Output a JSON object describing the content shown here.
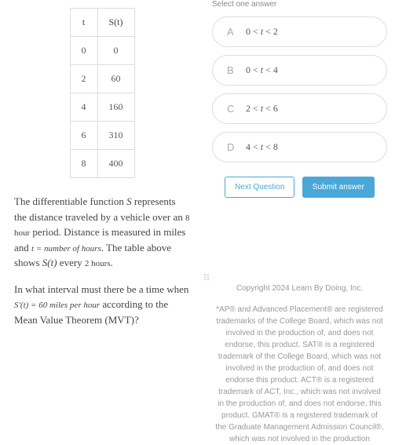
{
  "table": {
    "headers": [
      "t",
      "S(t)"
    ],
    "rows": [
      [
        "0",
        "0"
      ],
      [
        "2",
        "60"
      ],
      [
        "4",
        "160"
      ],
      [
        "6",
        "310"
      ],
      [
        "8",
        "400"
      ]
    ]
  },
  "question": {
    "p1_a": "The differentiable function ",
    "p1_S": "S",
    "p1_b": " represents the distance traveled by a vehicle over an ",
    "p1_period": "8 hour",
    "p1_c": " period. Distance is measured in miles and ",
    "p1_tdef": "t = number of hours",
    "p1_d": ". The table above shows ",
    "p1_St": "S(t)",
    "p1_e": " every ",
    "p1_interval": "2 hours",
    "p1_f": ".",
    "p2_a": "In what interval must there be a time when ",
    "p2_deriv": "S′(t) = 60 miles per hour",
    "p2_b": " according to the Mean Value Theorem (MVT)?"
  },
  "prompt": "Select one answer",
  "options": [
    {
      "letter": "A",
      "text": "0 < t < 2"
    },
    {
      "letter": "B",
      "text": "0 < t < 4"
    },
    {
      "letter": "C",
      "text": "2 < t < 6"
    },
    {
      "letter": "D",
      "text": "4 < t < 8"
    }
  ],
  "buttons": {
    "next": "Next Question",
    "submit": "Submit answer"
  },
  "footer": {
    "copyright": "Copyright 2024 Learn By Doing, Inc.",
    "disclaimer": "*AP® and Advanced Placement® are registered trademarks of the College Board, which was not involved in the production of, and does not endorse, this product. SAT® is a registered trademark of the College Board, which was not involved in the production of, and does not endorse this product. ACT® is a registered trademark of ACT, Inc., which was not involved in the production of, and does not endorse, this product. GMAT® is a registered trademark of the Graduate Management Admission Council®, which was not involved in the production"
  },
  "chart_data": {
    "type": "table",
    "title": "Distance S(t) over time t",
    "columns": [
      "t",
      "S(t)"
    ],
    "rows": [
      [
        0,
        0
      ],
      [
        2,
        60
      ],
      [
        4,
        160
      ],
      [
        6,
        310
      ],
      [
        8,
        400
      ]
    ]
  }
}
